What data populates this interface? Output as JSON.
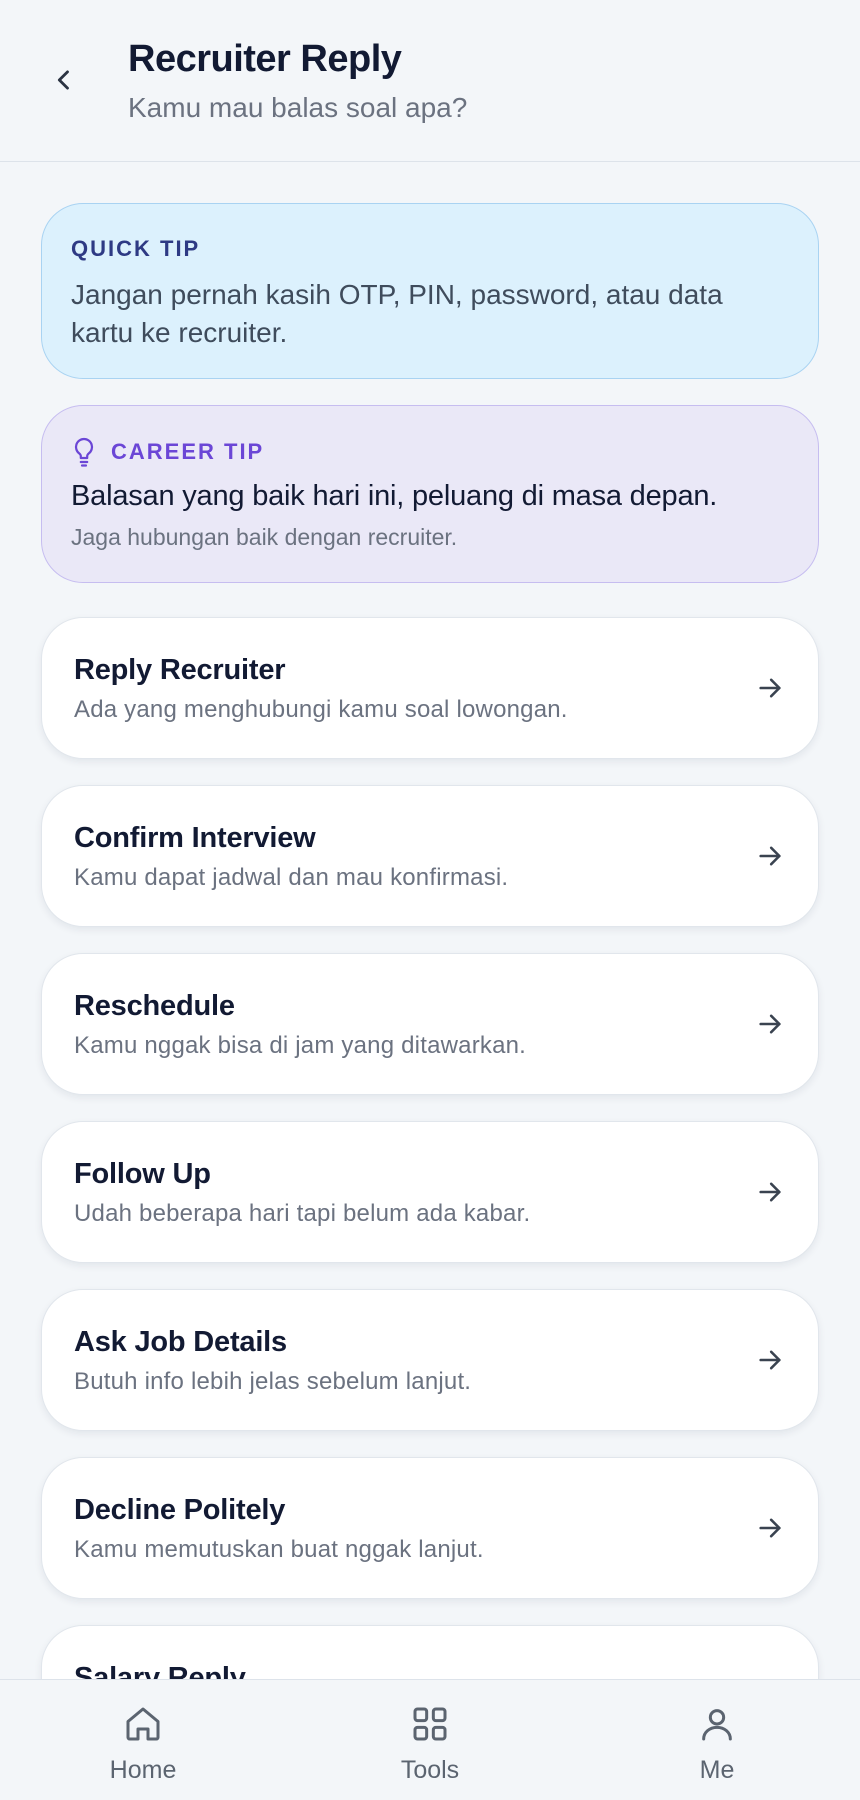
{
  "header": {
    "title": "Recruiter Reply",
    "subtitle": "Kamu mau balas soal apa?"
  },
  "quick_tip": {
    "label": "QUICK TIP",
    "text": "Jangan pernah kasih OTP, PIN, password, atau data kartu ke recruiter."
  },
  "career_tip": {
    "label": "CAREER TIP",
    "heading": "Balasan yang baik hari ini, peluang di masa depan.",
    "sub": "Jaga hubungan baik dengan recruiter."
  },
  "options": [
    {
      "title": "Reply Recruiter",
      "desc": "Ada yang menghubungi kamu soal lowongan."
    },
    {
      "title": "Confirm Interview",
      "desc": "Kamu dapat jadwal dan mau konfirmasi."
    },
    {
      "title": "Reschedule",
      "desc": "Kamu nggak bisa di jam yang ditawarkan."
    },
    {
      "title": "Follow Up",
      "desc": "Udah beberapa hari tapi belum ada kabar."
    },
    {
      "title": "Ask Job Details",
      "desc": "Butuh info lebih jelas sebelum lanjut."
    },
    {
      "title": "Decline Politely",
      "desc": "Kamu memutuskan buat nggak lanjut."
    },
    {
      "title": "Salary Reply",
      "desc": ""
    }
  ],
  "nav": {
    "home": "Home",
    "tools": "Tools",
    "me": "Me"
  },
  "colors": {
    "quick_tip_bg": "#dcf1fd",
    "career_tip_bg": "#eae8f7",
    "career_accent": "#6b46d6",
    "quick_accent": "#2e3a84"
  }
}
